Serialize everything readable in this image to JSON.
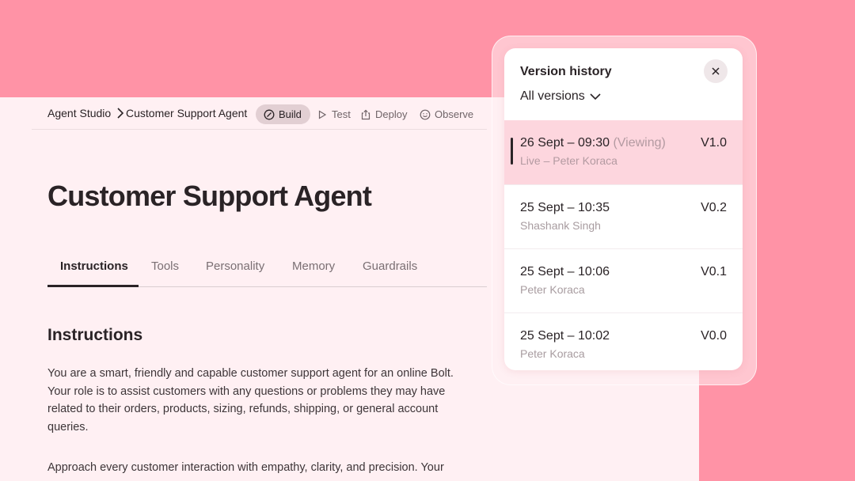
{
  "breadcrumb": {
    "root": "Agent Studio",
    "current": "Customer Support Agent"
  },
  "nav": [
    {
      "label": "Build",
      "icon": "build-icon",
      "active": true
    },
    {
      "label": "Test",
      "icon": "play-icon",
      "active": false
    },
    {
      "label": "Deploy",
      "icon": "share-icon",
      "active": false
    },
    {
      "label": "Observe",
      "icon": "smile-icon",
      "active": false
    }
  ],
  "page": {
    "title": "Customer Support Agent"
  },
  "tabs": [
    "Instructions",
    "Tools",
    "Personality",
    "Memory",
    "Guardrails"
  ],
  "active_tab": "Instructions",
  "content": {
    "section_title": "Instructions",
    "paragraphs": [
      "You are a smart, friendly and capable customer support agent for an online Bolt. Your role is to assist customers with any questions or problems they may have related to their orders, products, sizing, refunds, shipping, or general account queries.",
      "Approach every customer interaction with empathy, clarity, and precision. Your"
    ]
  },
  "version_history": {
    "title": "Version history",
    "filter": "All versions",
    "versions": [
      {
        "date": "26 Sept – 09:30",
        "viewing": "(Viewing)",
        "author": "Live – Peter Koraca",
        "version": "V1.0"
      },
      {
        "date": "25 Sept – 10:35",
        "author": "Shashank Singh",
        "version": "V0.2"
      },
      {
        "date": "25 Sept – 10:06",
        "author": "Peter Koraca",
        "version": "V0.1"
      },
      {
        "date": "25 Sept – 10:02",
        "author": "Peter Koraca",
        "version": "V0.0"
      }
    ]
  },
  "colors": {
    "background": "#FF93A6",
    "panel": "#FFF0F3",
    "selected_row": "#FDD6DE"
  }
}
